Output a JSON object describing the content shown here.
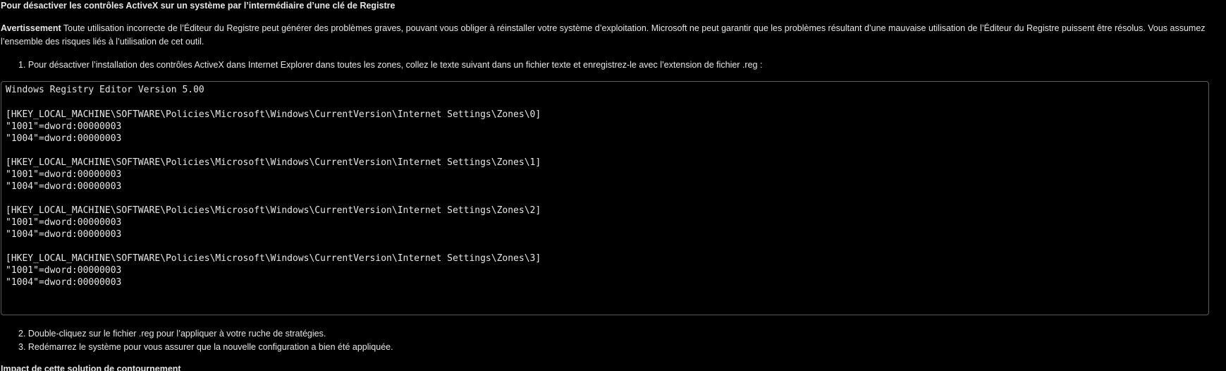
{
  "heading": "Pour désactiver les contrôles ActiveX sur un système par l’intermédiaire d’une clé de Registre",
  "warning": {
    "label": "Avertissement",
    "text": " Toute utilisation incorrecte de l’Éditeur du Registre peut générer des problèmes graves, pouvant vous obliger à réinstaller votre système d’exploitation. Microsoft ne peut garantir que les problèmes résultant d’une mauvaise utilisation de l’Éditeur du Registre puissent être résolus. Vous assumez l’ensemble des risques liés à l’utilisation de cet outil."
  },
  "steps": [
    "1. Pour désactiver l’installation des contrôles ActiveX dans Internet Explorer dans toutes les zones, collez le texte suivant dans un fichier texte et enregistrez-le avec l’extension de fichier .reg :",
    "2. Double-cliquez sur le fichier .reg pour l’appliquer à votre ruche de stratégies.",
    "3. Redémarrez le système pour vous assurer que la nouvelle configuration a bien été appliquée."
  ],
  "code_lines": [
    "Windows Registry Editor Version 5.00",
    "",
    "[HKEY_LOCAL_MACHINE\\SOFTWARE\\Policies\\Microsoft\\Windows\\CurrentVersion\\Internet Settings\\Zones\\0]",
    "\"1001\"=dword:00000003",
    "\"1004\"=dword:00000003",
    "",
    "[HKEY_LOCAL_MACHINE\\SOFTWARE\\Policies\\Microsoft\\Windows\\CurrentVersion\\Internet Settings\\Zones\\1]",
    "\"1001\"=dword:00000003",
    "\"1004\"=dword:00000003",
    "",
    "[HKEY_LOCAL_MACHINE\\SOFTWARE\\Policies\\Microsoft\\Windows\\CurrentVersion\\Internet Settings\\Zones\\2]",
    "\"1001\"=dword:00000003",
    "\"1004\"=dword:00000003",
    "",
    "[HKEY_LOCAL_MACHINE\\SOFTWARE\\Policies\\Microsoft\\Windows\\CurrentVersion\\Internet Settings\\Zones\\3]",
    "\"1001\"=dword:00000003",
    "\"1004\"=dword:00000003"
  ],
  "impact_heading": "Impact de cette solution de contournement"
}
